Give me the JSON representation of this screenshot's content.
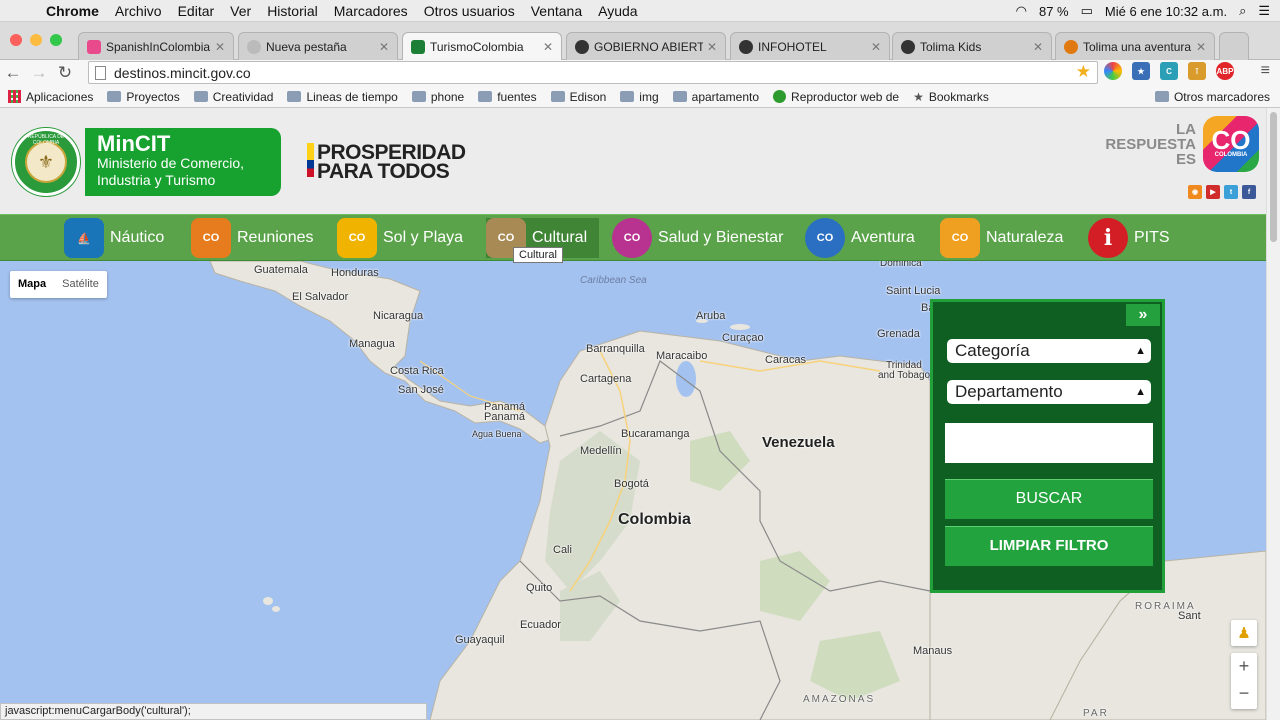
{
  "macos": {
    "app": "Chrome",
    "menus": [
      "Archivo",
      "Editar",
      "Ver",
      "Historial",
      "Marcadores",
      "Otros usuarios",
      "Ventana",
      "Ayuda"
    ],
    "battery": "87 %",
    "clock": "Mié 6 ene  10:32 a.m."
  },
  "browser": {
    "tabs": [
      {
        "label": "SpanishInColombia"
      },
      {
        "label": "Nueva pestaña"
      },
      {
        "label": "TurismoColombia",
        "active": true
      },
      {
        "label": "GOBIERNO ABIERTO"
      },
      {
        "label": "INFOHOTEL"
      },
      {
        "label": "Tolima Kids"
      },
      {
        "label": "Tolima una aventura ec"
      }
    ],
    "url": "destinos.mincit.gov.co",
    "bookmarks": [
      "Aplicaciones",
      "Proyectos",
      "Creatividad",
      "Lineas de tiempo",
      "phone",
      "fuentes",
      "Edison",
      "img",
      "apartamento",
      "Reproductor web de",
      "Bookmarks"
    ],
    "other_bookmarks": "Otros marcadores",
    "status_text": "javascript:menuCargarBody('cultural');"
  },
  "site": {
    "seal_text": "REPÚBLICA DE COLOMBIA",
    "mincit_title": "MinCIT",
    "mincit_sub1": "Ministerio de Comercio,",
    "mincit_sub2": "Industria y Turismo",
    "prosperidad1": "PROSPERIDAD",
    "prosperidad2": "PARA TODOS",
    "respuesta1": "LA",
    "respuesta2": "RESPUESTA",
    "respuesta3": "ES",
    "co_logo": "CO",
    "co_sub": "COLOMBIA",
    "nav": [
      {
        "label": "Náutico",
        "color": "#1a74b8"
      },
      {
        "label": "Reuniones",
        "color": "#e67c1e"
      },
      {
        "label": "Sol y Playa",
        "color": "#f0b400"
      },
      {
        "label": "Cultural",
        "color": "#a88a55",
        "active": true
      },
      {
        "label": "Salud y Bienestar",
        "color": "#b8328f"
      },
      {
        "label": "Aventura",
        "color": "#2a6fc1"
      },
      {
        "label": "Naturaleza",
        "color": "#f0a020"
      },
      {
        "label": "PITS",
        "color": "#d41e26"
      }
    ],
    "tooltip": "Cultural"
  },
  "map": {
    "type_options": [
      "Mapa",
      "Satélite"
    ],
    "labels": {
      "guatemala": "Guatemala",
      "honduras": "Honduras",
      "elsalvador": "El Salvador",
      "nicaragua": "Nicaragua",
      "managua": "Managua",
      "costarica": "Costa Rica",
      "sanjose": "San José",
      "panama": "Panamá",
      "panama2": "Panamá",
      "aguabuena": "Agua Buena",
      "caribbean": "Caribbean Sea",
      "aruba": "Aruba",
      "curacao": "Curaçao",
      "barranquilla": "Barranquilla",
      "maracaibo": "Maracaibo",
      "caracas": "Caracas",
      "cartagena": "Cartagena",
      "bucaramanga": "Bucaramanga",
      "venezuela": "Venezuela",
      "medellin": "Medellín",
      "bogota": "Bogotá",
      "colombia": "Colombia",
      "cali": "Cali",
      "quito": "Quito",
      "ecuador": "Ecuador",
      "guayaquil": "Guayaquil",
      "dominica": "Dominica",
      "saintlucia": "Saint Lucia",
      "barbados": "Ba",
      "grenada": "Grenada",
      "trinidad": "Trinidad",
      "tobago": "and Tobago",
      "roraima": "RORAIMA",
      "manaus": "Manaus",
      "amazonas": "AMAZONAS",
      "santarem": "Sant",
      "para": "PAR",
      "zoom_in": "+",
      "zoom_out": "−"
    }
  },
  "search": {
    "toggle": "»",
    "category": "Categoría",
    "department": "Departamento",
    "search_button": "BUSCAR",
    "clear_button": "LIMPIAR FILTRO"
  }
}
